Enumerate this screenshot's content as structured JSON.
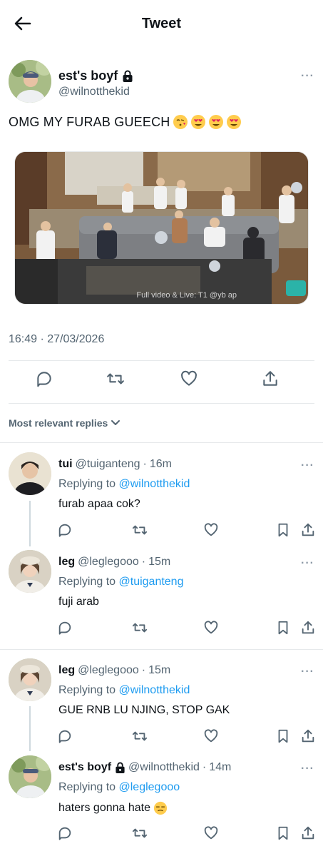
{
  "header": {
    "title": "Tweet"
  },
  "main_tweet": {
    "name": "est's boyf",
    "handle": "@wilnotthekid",
    "text": "OMG MY FURAB GUEECH",
    "media_caption": "Full video & Live: T1 @yb ap",
    "timestamp": "16:49 · 27/03/2026"
  },
  "replies_label": "Most relevant replies",
  "replies": [
    {
      "name": "tui",
      "handle": "@tuiganteng",
      "time": "16m",
      "replying_prefix": "Replying to",
      "replying_to": "@wilnotthekid",
      "text": "furab apaa cok?"
    },
    {
      "name": "leg",
      "handle": "@leglegooo",
      "time": "15m",
      "replying_prefix": "Replying to",
      "replying_to": "@tuiganteng",
      "text": "fuji arab"
    },
    {
      "name": "leg",
      "handle": "@leglegooo",
      "time": "15m",
      "replying_prefix": "Replying to",
      "replying_to": "@wilnotthekid",
      "text": "GUE RNB LU NJING, STOP GAK"
    },
    {
      "name": "est's boyf",
      "handle": "@wilnotthekid",
      "time": "14m",
      "replying_prefix": "Replying to",
      "replying_to": "@leglegooo",
      "text": "haters gonna hate"
    }
  ],
  "colors": {
    "accent": "#1d9bf0",
    "secondary_text": "#536471",
    "divider": "#e6e9eb"
  },
  "icons": {
    "back": "arrow-left-icon",
    "lock": "lock-icon",
    "more": "more-icon",
    "reply": "reply-icon",
    "retweet": "retweet-icon",
    "like": "heart-icon",
    "share": "share-icon",
    "bookmark": "bookmark-icon"
  }
}
